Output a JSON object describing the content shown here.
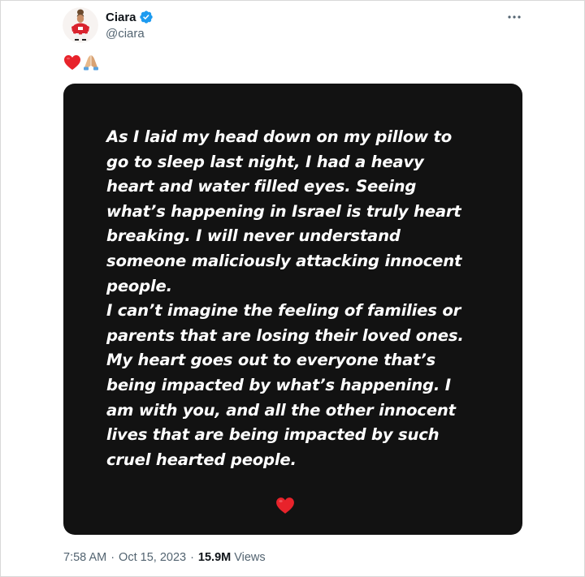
{
  "user": {
    "display_name": "Ciara",
    "handle": "@ciara",
    "verified": true
  },
  "tweet": {
    "emojis": [
      "red-heart",
      "folded-hands"
    ],
    "media_text": "As I laid my head down on my pillow to\ngo to sleep last night, I had a heavy\nheart and water filled eyes. Seeing\nwhat’s happening in Israel is truly heart\nbreaking. I will never understand\nsomeone maliciously attacking innocent\npeople.\nI can’t imagine the feeling of families or\nparents that are losing their loved ones.\nMy heart goes out to everyone that’s\nbeing impacted by what’s happening. I\nam with you, and all the other innocent\nlives that are being impacted by such\ncruel hearted people.",
    "media_emoji": "red-heart"
  },
  "meta": {
    "time": "7:58 AM",
    "date": "Oct 15, 2023",
    "views_count": "15.9M",
    "views_label": "Views",
    "separator": "·"
  },
  "colors": {
    "verified_blue": "#1d9bf0",
    "secondary_text": "#536471",
    "media_background": "#121212",
    "heart_red": "#e8232b"
  }
}
